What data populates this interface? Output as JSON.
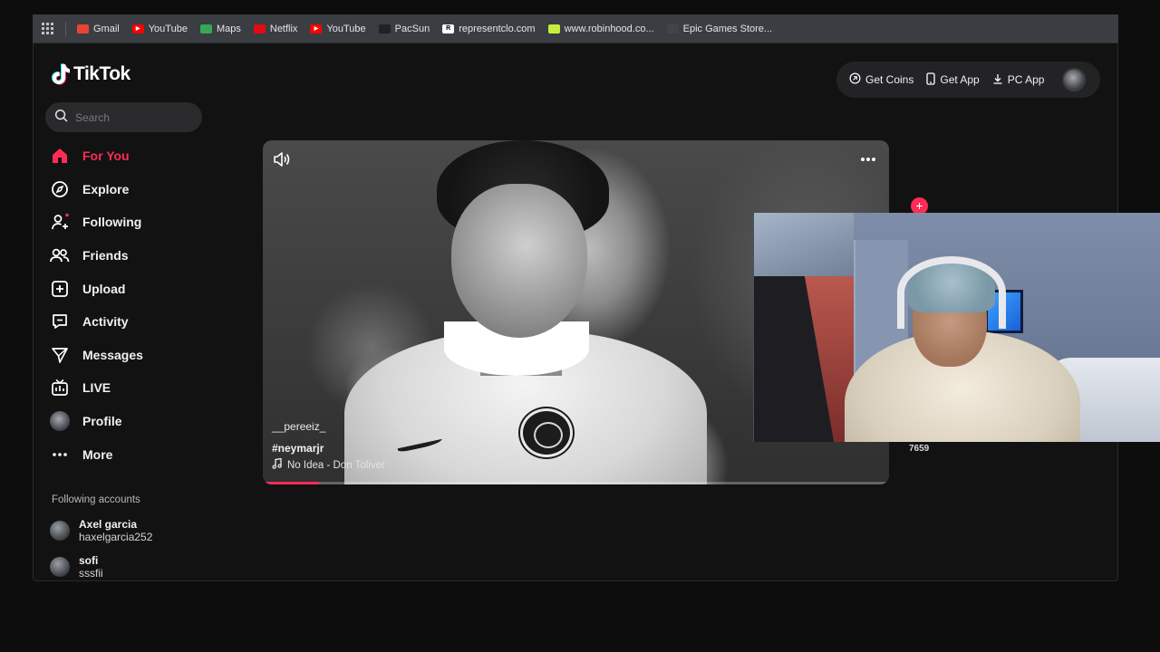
{
  "bookmarks": [
    {
      "label": "Gmail",
      "icon": "gmail-icon",
      "color": "#ea4335"
    },
    {
      "label": "YouTube",
      "icon": "youtube-icon",
      "color": "#ff0000"
    },
    {
      "label": "Maps",
      "icon": "maps-icon",
      "color": "#34a853"
    },
    {
      "label": "Netflix",
      "icon": "netflix-icon",
      "color": "#e50914"
    },
    {
      "label": "YouTube",
      "icon": "youtube-icon",
      "color": "#ff0000"
    },
    {
      "label": "PacSun",
      "icon": "pacsun-icon",
      "color": "#222222"
    },
    {
      "label": "representclo.com",
      "icon": "represent-icon",
      "color": "#ffffff"
    },
    {
      "label": "www.robinhood.co...",
      "icon": "robinhood-icon",
      "color": "#c4ef3c"
    },
    {
      "label": "Epic Games Store...",
      "icon": "epic-games-icon",
      "color": "#444444"
    }
  ],
  "brand": {
    "name": "TikTok",
    "accent": "#fe2c55"
  },
  "search": {
    "placeholder": "Search"
  },
  "nav": [
    {
      "label": "For You",
      "icon": "home-icon",
      "active": true
    },
    {
      "label": "Explore",
      "icon": "compass-icon"
    },
    {
      "label": "Following",
      "icon": "following-icon"
    },
    {
      "label": "Friends",
      "icon": "friends-icon"
    },
    {
      "label": "Upload",
      "icon": "upload-icon"
    },
    {
      "label": "Activity",
      "icon": "activity-icon"
    },
    {
      "label": "Messages",
      "icon": "messages-icon"
    },
    {
      "label": "LIVE",
      "icon": "live-icon"
    },
    {
      "label": "Profile",
      "icon": "profile-avatar"
    },
    {
      "label": "More",
      "icon": "more-dots-icon"
    }
  ],
  "following": {
    "title": "Following accounts",
    "accounts": [
      {
        "name": "Axel garcia",
        "handle": "haxelgarcia252"
      },
      {
        "name": "sofi",
        "handle": "sssfii"
      }
    ]
  },
  "header": {
    "get_coins": "Get Coins",
    "get_app": "Get App",
    "pc_app": "PC App"
  },
  "video": {
    "username": "__pereeiz_",
    "hashtag": "#neymarjr",
    "music": "No Idea - Don Toliver",
    "progress": 0.09
  },
  "side_actions": {
    "count": "7659"
  }
}
